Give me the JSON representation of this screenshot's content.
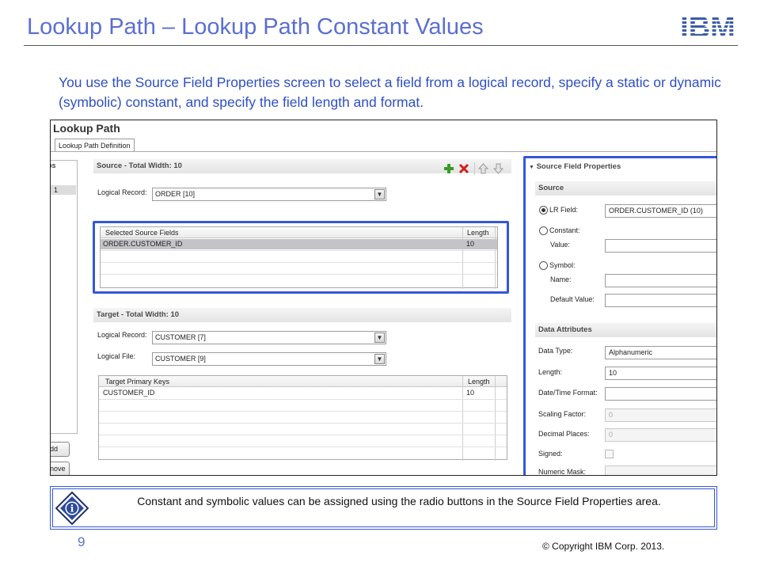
{
  "slide": {
    "title": "Lookup Path – Lookup Path Constant Values",
    "logo_text": "IBM",
    "intro": "You use the Source Field Properties screen to select a field from a logical record, specify a static or dynamic (symbolic) constant, and specify the field length and format.",
    "page_number": "9",
    "copyright": "© Copyright  IBM Corp. 2013."
  },
  "screen": {
    "title": "Lookup Path",
    "tab": "Lookup Path Definition",
    "left_strip": {
      "header": "ps",
      "row": "1",
      "add_button": "dd",
      "remove_button": "nove"
    },
    "source": {
      "header": "Source - Total Width: 10",
      "logical_record_label": "Logical Record:",
      "logical_record_value": "ORDER [10]",
      "grid_headers": [
        "Selected Source Fields",
        "Length"
      ],
      "rows": [
        [
          "ORDER.CUSTOMER_ID",
          "10"
        ]
      ]
    },
    "target": {
      "header": "Target - Total Width: 10",
      "logical_record_label": "Logical Record:",
      "logical_record_value": "CUSTOMER [7]",
      "logical_file_label": "Logical File:",
      "logical_file_value": "CUSTOMER [9]",
      "grid_headers": [
        "Target Primary Keys",
        "Length"
      ],
      "rows": [
        [
          "CUSTOMER_ID",
          "10"
        ]
      ]
    },
    "properties": {
      "header": "Source Field Properties",
      "source_section": "Source",
      "lr_field_label": "LR Field:",
      "lr_field_value": "ORDER.CUSTOMER_ID (10)",
      "constant_label": "Constant:",
      "value_label": "Value:",
      "symbol_label": "Symbol:",
      "name_label": "Name:",
      "default_value_label": "Default Value:",
      "data_attributes_section": "Data Attributes",
      "data_type_label": "Data Type:",
      "data_type_value": "Alphanumeric",
      "length_label": "Length:",
      "length_value": "10",
      "datetime_label": "Date/Time Format:",
      "scaling_label": "Scaling Factor:",
      "scaling_value": "0",
      "decimal_label": "Decimal Places:",
      "decimal_value": "0",
      "signed_label": "Signed:",
      "numeric_mask_label": "Numeric Mask:"
    }
  },
  "note": {
    "text": "Constant and symbolic values can be assigned using the radio buttons in the Source Field Properties area."
  },
  "colors": {
    "title_blue": "#5b6fd0",
    "intro_blue": "#2e4fc4",
    "highlight_blue": "#3358d8",
    "ibm_blue": "#3a5ba8"
  }
}
